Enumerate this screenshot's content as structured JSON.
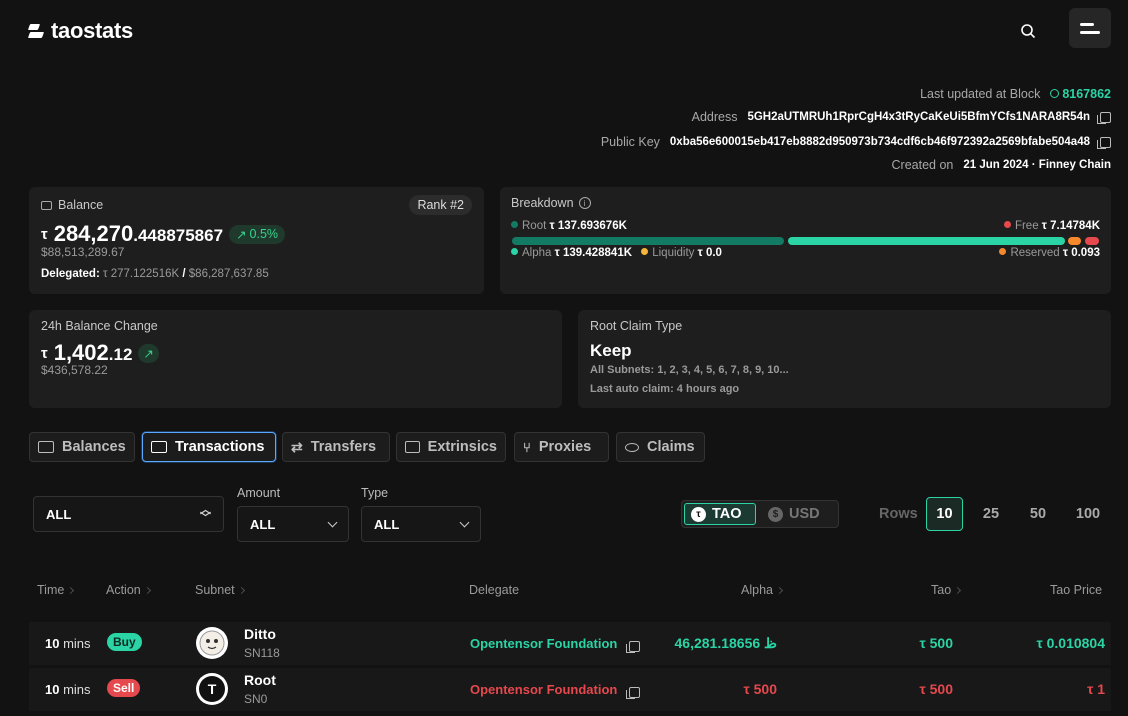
{
  "header": {
    "brand": "taostats"
  },
  "account": {
    "last_updated_label": "Last updated at Block",
    "block": "8167862",
    "address_label": "Address",
    "address": "5GH2aUTMRUh1RprCgH4x3tRyCaKeUi5BfmYCfs1NARA8R54n",
    "pubkey_label": "Public Key",
    "pubkey": "0xba56e600015eb417eb8882d950973b734cdf6cb46f972392a2569bfabe504a48",
    "created_label": "Created on",
    "created": "21 Jun 2024 · Finney Chain"
  },
  "balance": {
    "label": "Balance",
    "rank": "Rank #2",
    "tau": "τ",
    "int": "284,270",
    "dec": ".448875867",
    "change": "0.5%",
    "usd": "$88,513,289.67",
    "delegated_label": "Delegated:",
    "delegated_tao": "τ 277.122516K",
    "delegated_sep": "/",
    "delegated_usd": "$86,287,637.85"
  },
  "breakdown": {
    "label": "Breakdown",
    "root_label": "Root",
    "root": "τ 137.693676K",
    "free_label": "Free",
    "free": "τ 7.14784K",
    "alpha_label": "Alpha",
    "alpha": "τ 139.428841K",
    "liquidity_label": "Liquidity",
    "liquidity": "τ 0.0",
    "reserved_label": "Reserved",
    "reserved": "τ 0.093",
    "colors": {
      "root": "#137a63",
      "alpha": "#2ad4a5",
      "liquidity": "#f5b73b",
      "free": "#e5484d",
      "reserved": "#f5892b"
    }
  },
  "change24": {
    "label": "24h Balance Change",
    "tau": "τ",
    "int": "1,402",
    "dec": ".12",
    "usd": "$436,578.22"
  },
  "root_claim": {
    "label": "Root Claim Type",
    "value": "Keep",
    "subnets": "All Subnets: 1, 2, 3, 4, 5, 6, 7, 8, 9, 10...",
    "last": "Last auto claim: 4 hours ago"
  },
  "tabs": [
    "Balances",
    "Transactions",
    "Transfers",
    "Extrinsics",
    "Proxies",
    "Claims"
  ],
  "filters": {
    "subnet_value": "ALL",
    "amount_label": "Amount",
    "amount_value": "ALL",
    "type_label": "Type",
    "type_value": "ALL"
  },
  "currency": {
    "tao": "TAO",
    "usd": "USD",
    "tao_symbol": "τ",
    "usd_symbol": "$"
  },
  "rows": {
    "label": "Rows",
    "options": [
      "10",
      "25",
      "50",
      "100"
    ]
  },
  "table": {
    "headers": [
      "Time",
      "Action",
      "Subnet",
      "Delegate",
      "Alpha",
      "Tao",
      "Tao Price"
    ],
    "rows": [
      {
        "time": "10",
        "time_unit": "mins",
        "action": "Buy",
        "subnet": "Ditto",
        "netuid": "SN118",
        "delegate": "Opentensor Foundation",
        "alpha": "ظ 46,281.18656",
        "tao": "τ 500",
        "price": "τ 0.010804"
      },
      {
        "time": "10",
        "time_unit": "mins",
        "action": "Sell",
        "subnet": "Root",
        "netuid": "SN0",
        "avatar_letter": "T",
        "delegate": "Opentensor Foundation",
        "alpha": "τ 500",
        "tao": "τ 500",
        "price": "τ 1"
      }
    ]
  }
}
